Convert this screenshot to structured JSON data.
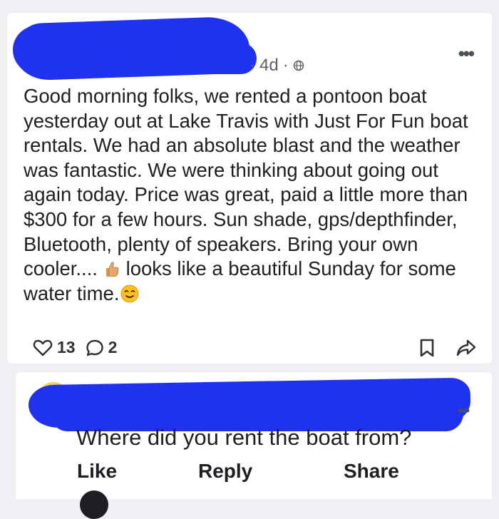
{
  "post": {
    "age": "4d",
    "separator": "·",
    "text_part1": "Good morning folks, we rented a pontoon boat yesterday out at Lake Travis with Just For Fun boat rentals. We had an absolute blast and the weather was fantastic. We were thinking about going out again today. Price was great, paid a little more than $300 for a few hours. Sun shade, gps/depthfinder, Bluetooth, plenty of speakers. Bring your own cooler....",
    "text_part2": " looks like a beautiful Sunday for some water time.",
    "likes": "13",
    "comments": "2"
  },
  "comment": {
    "text": "Where did you rent the boat from?",
    "like_label": "Like",
    "reply_label": "Reply",
    "share_label": "Share"
  },
  "colors": {
    "redaction": "#1e32f0",
    "background": "#eef0f3"
  },
  "icons": [
    "globe-icon",
    "more-icon",
    "thumbs-up-emoji",
    "smile-emoji",
    "heart-icon",
    "comment-icon",
    "bookmark-icon",
    "share-icon"
  ]
}
